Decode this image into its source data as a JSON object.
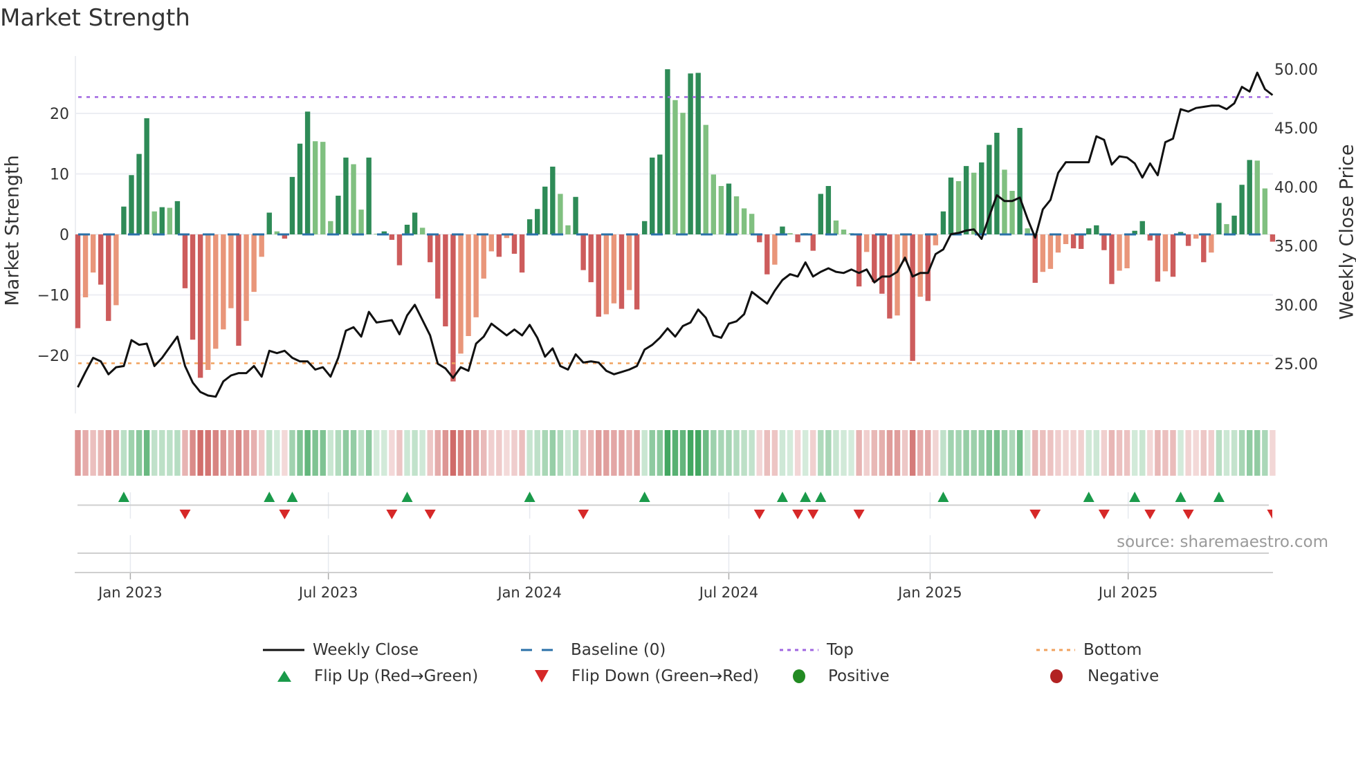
{
  "title": "Market Strength",
  "source": "source: sharemaestro.com",
  "legend": {
    "weekly_close": "Weekly Close",
    "baseline": "Baseline (0)",
    "top": "Top",
    "bottom": "Bottom",
    "flip_up": "Flip Up (Red→Green)",
    "flip_down": "Flip Down (Green→Red)",
    "positive": "Positive",
    "negative": "Negative"
  },
  "colors": {
    "bar_pos_rising": "#2e8b57",
    "bar_pos_falling": "#80c080",
    "bar_neg_falling": "#cd5c5c",
    "bar_neg_rising": "#e9967a",
    "baseline": "#2a70a8",
    "top": "#a066e0",
    "bottom": "#f0a25e",
    "price": "#111111",
    "flip_up": "#1a9a4a",
    "flip_down": "#d62828",
    "positive": "#228b22",
    "negative": "#b22222",
    "heat_green": "#2e9d4f",
    "heat_red": "#c8524f"
  },
  "chart_data": {
    "type": "bar",
    "title": "Market Strength",
    "ylabel": "Market Strength",
    "y2label": "Weekly Close Price",
    "start_week": "2022-11-14",
    "frequency": "weekly",
    "ylim": [
      -29.6,
      29.5
    ],
    "y2lim": [
      20.6,
      51.2
    ],
    "top_level": 22.7,
    "bottom_level": -21.3,
    "baseline": 0,
    "left_ticks": [
      {
        "value": 20,
        "label": "20"
      },
      {
        "value": 10,
        "label": "10"
      },
      {
        "value": 0,
        "label": "0"
      },
      {
        "value": -10,
        "label": "−10"
      },
      {
        "value": -20,
        "label": "−20"
      }
    ],
    "right_ticks": [
      {
        "value": 50,
        "label": "50.00"
      },
      {
        "value": 45,
        "label": "45.00"
      },
      {
        "value": 40,
        "label": "40.00"
      },
      {
        "value": 35,
        "label": "35.00"
      },
      {
        "value": 30,
        "label": "30.00"
      },
      {
        "value": 25,
        "label": "25.00"
      }
    ],
    "x_ticks": [
      {
        "date": "2023-01-01",
        "label": "Jan 2023"
      },
      {
        "date": "2023-07-01",
        "label": "Jul 2023"
      },
      {
        "date": "2024-01-01",
        "label": "Jan 2024"
      },
      {
        "date": "2024-07-01",
        "label": "Jul 2024"
      },
      {
        "date": "2025-01-01",
        "label": "Jan 2025"
      },
      {
        "date": "2025-07-01",
        "label": "Jul 2025"
      }
    ],
    "strength": [
      -15.5,
      -10.4,
      -6.3,
      -8.3,
      -14.3,
      -11.7,
      4.6,
      9.8,
      13.3,
      19.2,
      3.8,
      4.5,
      4.4,
      5.5,
      -8.9,
      -17.4,
      -23.7,
      -22.4,
      -18.9,
      -15.7,
      -12.2,
      -18.4,
      -14.3,
      -9.5,
      -3.7,
      3.6,
      0.5,
      -0.7,
      9.5,
      15.0,
      20.3,
      15.4,
      15.3,
      2.2,
      6.4,
      12.7,
      11.6,
      4.1,
      12.7,
      0.1,
      0.5,
      -0.9,
      -5.1,
      1.6,
      3.6,
      1.1,
      -4.6,
      -10.6,
      -15.2,
      -24.3,
      -19.7,
      -16.8,
      -13.7,
      -7.3,
      -2.8,
      -3.7,
      -0.6,
      -3.2,
      -6.3,
      2.5,
      4.2,
      7.9,
      11.2,
      6.7,
      1.5,
      6.2,
      -5.9,
      -7.9,
      -13.6,
      -13.2,
      -11.4,
      -12.3,
      -9.2,
      -12.4,
      2.2,
      12.7,
      13.2,
      27.3,
      22.2,
      20.1,
      26.6,
      26.7,
      18.1,
      9.9,
      8.0,
      8.4,
      6.3,
      4.3,
      3.4,
      -1.3,
      -6.6,
      -5.0,
      1.3,
      0.2,
      -1.3,
      0.2,
      -2.7,
      6.7,
      8.0,
      2.3,
      0.8,
      0.2,
      -8.6,
      -2.9,
      -7.9,
      -9.8,
      -13.9,
      -13.4,
      -4.5,
      -20.9,
      -10.3,
      -11.0,
      -1.8,
      3.8,
      9.4,
      8.8,
      11.3,
      10.2,
      11.9,
      14.8,
      16.8,
      10.7,
      7.2,
      17.6,
      1.0,
      -8.0,
      -6.2,
      -5.7,
      -3.0,
      -1.6,
      -2.3,
      -2.4,
      1.0,
      1.5,
      -2.6,
      -8.2,
      -6.0,
      -5.6,
      0.6,
      2.2,
      -1.0,
      -7.8,
      -6.1,
      -7.0,
      0.4,
      -1.9,
      -0.7,
      -4.6,
      -3.0,
      5.2,
      1.7,
      3.1,
      8.2,
      12.3,
      12.2,
      7.6,
      -1.2
    ],
    "weekly_close": [
      23.0,
      24.3,
      25.5,
      25.2,
      24.1,
      24.7,
      24.8,
      27.0,
      26.6,
      26.7,
      24.8,
      25.5,
      26.4,
      27.3,
      24.8,
      23.4,
      22.6,
      22.3,
      22.2,
      23.5,
      24.0,
      24.2,
      24.2,
      24.8,
      23.9,
      26.1,
      25.9,
      26.1,
      25.5,
      25.2,
      25.2,
      24.5,
      24.7,
      23.9,
      25.5,
      27.8,
      28.1,
      27.3,
      29.4,
      28.5,
      28.6,
      28.7,
      27.5,
      29.1,
      30.0,
      28.7,
      27.4,
      25.0,
      24.6,
      23.8,
      24.7,
      24.4,
      26.7,
      27.3,
      28.4,
      27.9,
      27.4,
      27.9,
      27.4,
      28.3,
      27.2,
      25.6,
      26.3,
      24.8,
      24.5,
      25.8,
      25.1,
      25.2,
      25.1,
      24.4,
      24.1,
      24.3,
      24.5,
      24.8,
      26.2,
      26.6,
      27.2,
      28.0,
      27.3,
      28.2,
      28.5,
      29.6,
      28.9,
      27.4,
      27.2,
      28.4,
      28.6,
      29.2,
      31.1,
      30.6,
      30.1,
      31.2,
      32.1,
      32.6,
      32.4,
      33.6,
      32.4,
      32.8,
      33.1,
      32.8,
      32.7,
      33.0,
      32.7,
      33.0,
      31.9,
      32.4,
      32.4,
      32.8,
      34.0,
      32.4,
      32.7,
      32.7,
      34.3,
      34.7,
      36.0,
      36.1,
      36.3,
      36.4,
      35.6,
      37.5,
      39.3,
      38.8,
      38.8,
      39.1,
      37.3,
      35.7,
      38.1,
      38.9,
      41.2,
      42.1,
      42.1,
      42.1,
      42.1,
      44.3,
      44.0,
      41.9,
      42.6,
      42.5,
      42.0,
      40.8,
      42.0,
      41.0,
      43.8,
      44.1,
      46.6,
      46.4,
      46.7,
      46.8,
      46.9,
      46.9,
      46.6,
      47.1,
      48.5,
      48.1,
      49.7,
      48.3,
      47.8
    ]
  }
}
